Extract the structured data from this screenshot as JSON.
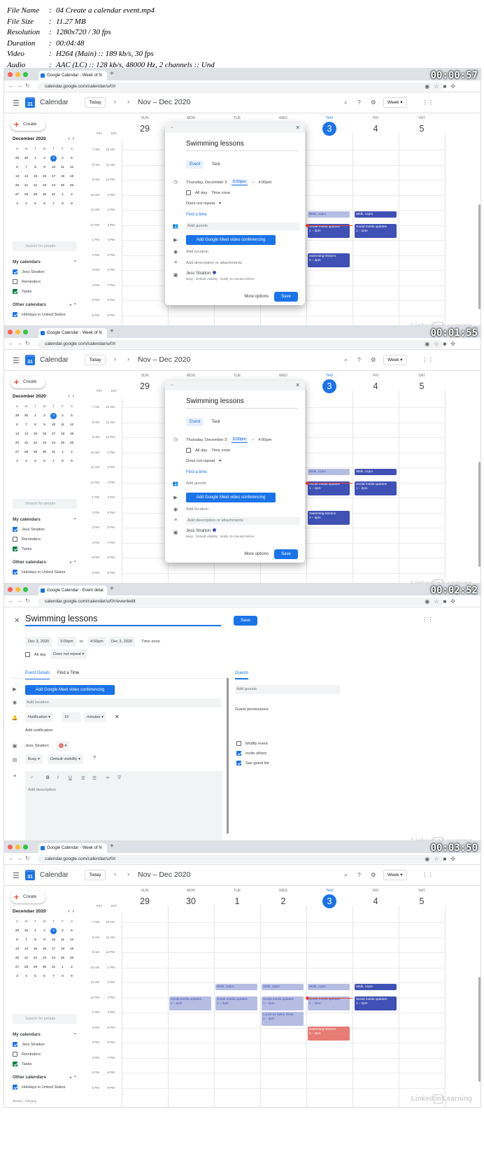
{
  "file_info": [
    {
      "k": "File Name",
      "v": "04 Create a calendar event.mp4"
    },
    {
      "k": "File Size",
      "v": "11.27 MB"
    },
    {
      "k": "Resolution",
      "v": "1280x720 / 30 fps"
    },
    {
      "k": "Duration",
      "v": "00:04:48"
    },
    {
      "k": "Video",
      "v": "H264 (Main) :: 189 kb/s, 30 fps"
    },
    {
      "k": "Audio",
      "v": "AAC (LC) :: 128 kb/s, 48000 Hz, 2 channels :: Und"
    }
  ],
  "colors": {
    "accent": "#1a73e8",
    "event_dark": "#3f51b5",
    "event_light": "#b6bde3",
    "event_red": "#e67c73",
    "now_line": "#ea4335"
  },
  "browser": {
    "tab_week": "Google Calendar - Week of N",
    "tab_edit": "Google Calendar - Event detai",
    "url_1": "calendar.google.com/calendar/u/0/r",
    "url_2": "calendar.google.com/calendar/u/0/r",
    "url_3": "calendar.google.com/calendar/u/0/r/eventedit",
    "url_4": "calendar.google.com/calendar/u/0/r"
  },
  "header": {
    "app": "Calendar",
    "today": "Today",
    "range": "Nov – Dec 2020",
    "view": "Week"
  },
  "sidebar": {
    "create": "Create",
    "month": "December 2020",
    "dow": [
      "S",
      "M",
      "T",
      "W",
      "T",
      "F",
      "S"
    ],
    "weeks": [
      [
        "29",
        "30",
        "1",
        "2",
        "3",
        "4",
        "5"
      ],
      [
        "6",
        "7",
        "8",
        "9",
        "10",
        "11",
        "12"
      ],
      [
        "13",
        "14",
        "15",
        "16",
        "17",
        "18",
        "19"
      ],
      [
        "20",
        "21",
        "22",
        "23",
        "24",
        "25",
        "26"
      ],
      [
        "27",
        "28",
        "29",
        "30",
        "31",
        "1",
        "2"
      ],
      [
        "3",
        "4",
        "5",
        "6",
        "7",
        "8",
        "9"
      ]
    ],
    "search": "Search for people",
    "my_calendars": "My calendars",
    "cal_items": [
      "Jess Stratton",
      "Reminders",
      "Tasks"
    ],
    "other_calendars": "Other calendars",
    "other_items": [
      "Holidays in United States"
    ],
    "footer": "Terms – Privacy"
  },
  "week": {
    "tz1": "PST",
    "tz2": "EST",
    "days": [
      {
        "n": "SUN",
        "d": "29"
      },
      {
        "n": "MON",
        "d": "30"
      },
      {
        "n": "TUE",
        "d": "1"
      },
      {
        "n": "WED",
        "d": "2"
      },
      {
        "n": "THU",
        "d": "3"
      },
      {
        "n": "FRI",
        "d": "4"
      },
      {
        "n": "SAT",
        "d": "5"
      }
    ],
    "hours_pst": [
      "7 AM",
      "8 AM",
      "9 AM",
      "10 AM",
      "11 AM",
      "12 PM",
      "1 PM",
      "2 PM",
      "3 PM",
      "4 PM",
      "5 PM",
      "6 PM"
    ],
    "hours_est": [
      "10 AM",
      "11 AM",
      "12 PM",
      "1 PM",
      "2 PM",
      "3 PM",
      "4 PM",
      "5 PM",
      "6 PM",
      "7 PM",
      "8 PM",
      "9 PM"
    ]
  },
  "events": {
    "walk": "Walk, 12pm",
    "social": "Social media updates",
    "social_time": "1 – 2pm",
    "swim": "Swimming lessons",
    "swim_time": "3 – 4pm",
    "lunch": "Lunch w/ Sales Team",
    "lunch_time": "2 – 3pm"
  },
  "quick_dialog": {
    "title": "Swimming lessons",
    "tab_event": "Event",
    "tab_task": "Task",
    "date": "Thursday, December 3",
    "start": "3:00pm",
    "dash": "–",
    "end": "4:00pm",
    "all_day": "All day",
    "time_zone": "Time zone",
    "repeat": "Does not repeat",
    "find_time": "Find a time",
    "add_guests": "Add guests",
    "meet": "Add Google Meet video conferencing",
    "add_location": "Add location",
    "add_desc": "Add description or attachments",
    "owner": "Jess Stratton",
    "owner_sub": "Busy · Default visibility · Notify 15 minutes before",
    "more_options": "More options",
    "save": "Save"
  },
  "edit_page": {
    "title": "Swimming lessons",
    "save": "Save",
    "start_date": "Dec 3, 2020",
    "start_time": "3:00pm",
    "to": "to",
    "end_time": "4:00pm",
    "end_date": "Dec 3, 2020",
    "time_zone": "Time zone",
    "all_day": "All day",
    "repeat": "Does not repeat",
    "tab_details": "Event Details",
    "tab_find": "Find a Time",
    "meet": "Add Google Meet video conferencing",
    "add_location": "Add location",
    "notif_type": "Notification",
    "notif_num": "15",
    "notif_unit": "minutes",
    "add_notif": "Add notification",
    "owner": "Jess Stratton",
    "busy": "Busy",
    "visibility": "Default visibility",
    "add_desc": "Add description",
    "guests_tab": "Guests",
    "add_guests": "Add guests",
    "guest_perm": "Guest permissions",
    "perms": [
      {
        "label": "Modify event",
        "on": false
      },
      {
        "label": "Invite others",
        "on": true
      },
      {
        "label": "See guest list",
        "on": true
      }
    ]
  },
  "frames": [
    {
      "time": "00:00:57"
    },
    {
      "time": "00:01:55"
    },
    {
      "time": "00:02:52"
    },
    {
      "time": "00:03:50"
    }
  ],
  "watermark": "Linked in Learning"
}
